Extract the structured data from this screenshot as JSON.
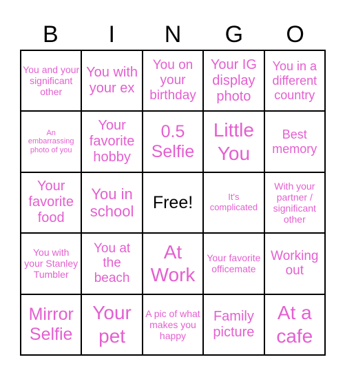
{
  "header": {
    "letters": [
      "B",
      "I",
      "N",
      "G",
      "O"
    ]
  },
  "colors": {
    "text_pink": "#e45fd0",
    "grid_border": "#000000",
    "free_text": "#000000"
  },
  "cells": [
    [
      "You and your significant other",
      "You with your ex",
      "You on your birthday",
      "Your IG display photo",
      "You in a different country"
    ],
    [
      "An embarrassing photo of you",
      "Your favorite hobby",
      "0.5 Selfie",
      "Little You",
      "Best memory"
    ],
    [
      "Your favorite food",
      "You in school",
      "Free!",
      "It's complicated",
      "With your partner / significant other"
    ],
    [
      "You with your Stanley Tumbler",
      "You at the beach",
      "At Work",
      "Your favorite officemate",
      "Working out"
    ],
    [
      "Mirror Selfie",
      "Your pet",
      "A pic of what makes you happy",
      "Family picture",
      "At a cafe"
    ]
  ]
}
